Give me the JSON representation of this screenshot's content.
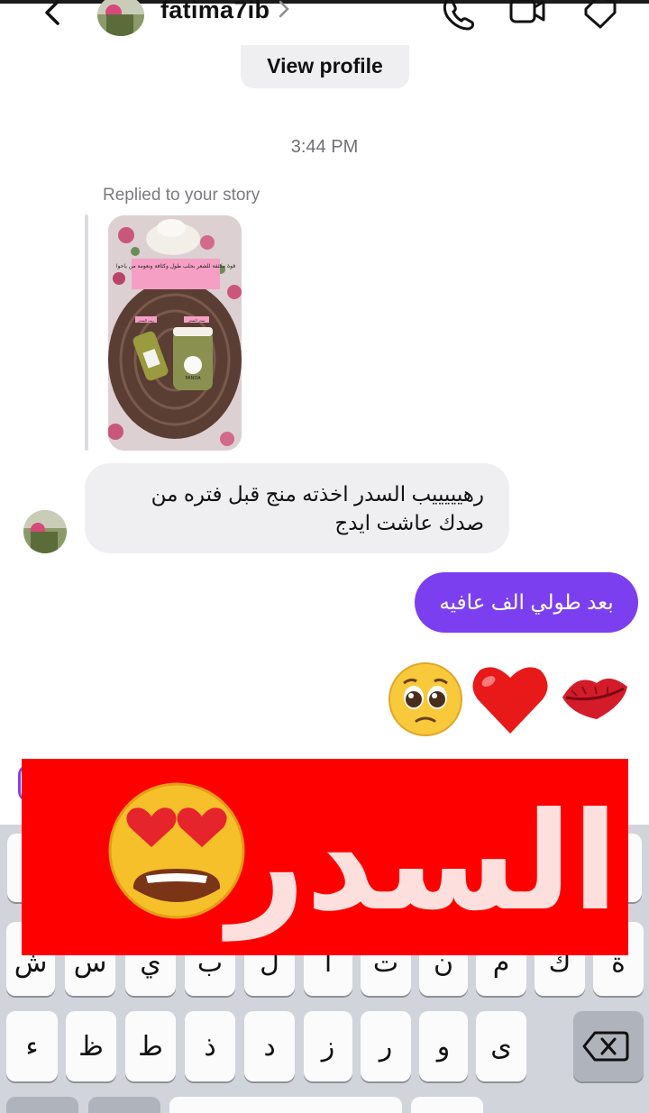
{
  "header": {
    "username": "fatima7ib",
    "back_icon": "chevron-left-icon",
    "chevron_icon": "chevron-right-icon",
    "call_icon": "phone-icon",
    "video_icon": "video-icon",
    "tag_icon": "tag-icon"
  },
  "view_profile_label": "View profile",
  "thread": {
    "time": "3:44 PM",
    "replied_label": "Replied to your story",
    "story": {
      "caption": "قوة مكثفة للشعر بحلب طول وكثافة ونعومة من ياحوا",
      "label_left": "زيت السدر",
      "label_right": "سدر الشعر",
      "brand": "PANDA"
    },
    "incoming_message": "رهيييييب السدر اخذته منج قبل فتره  من صدك عاشت ايدج",
    "outgoing_message": "بعد طولي الف عافيه",
    "reaction_emojis": [
      "pleading-face-emoji",
      "red-heart-emoji",
      "kiss-lips-emoji"
    ]
  },
  "banner": {
    "text": "السدر",
    "emoji": "heart-eyes-emoji",
    "background": "#fe0000",
    "text_color": "#fde0de"
  },
  "keyboard": {
    "row2": [
      "ش",
      "س",
      "ي",
      "ب",
      "ل",
      "ا",
      "ت",
      "ن",
      "م",
      "ك",
      "ة"
    ],
    "row3": [
      "ء",
      "ظ",
      "ط",
      "ذ",
      "د",
      "ز",
      "ر",
      "و",
      "ى"
    ],
    "backspace_icon": "backspace-icon"
  },
  "colors": {
    "accent": "#7b3ff0",
    "bubble_gray": "#efeff2",
    "keyboard_bg": "#d1d4da"
  }
}
